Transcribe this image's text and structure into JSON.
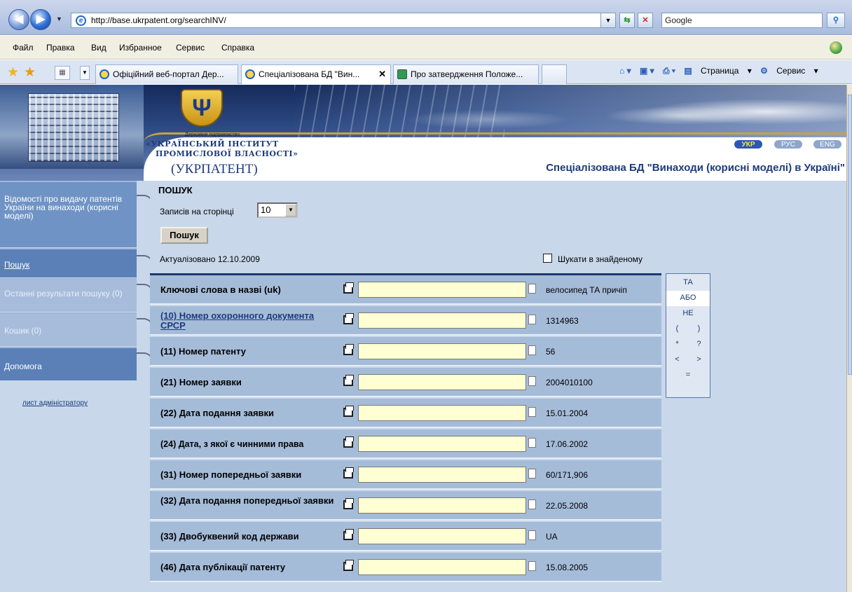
{
  "browser": {
    "url": "http://base.ukrpatent.org/searchINV/",
    "search_placeholder": "Google",
    "menu": [
      "Файл",
      "Правка",
      "Вид",
      "Избранное",
      "Сервис",
      "Справка"
    ],
    "tabs": [
      {
        "label": "Офіційний веб-портал Дер..."
      },
      {
        "label": "Спеціалізована БД \"Вин...",
        "close": "✕"
      },
      {
        "label": "Про затвердження Положе..."
      }
    ],
    "commands": {
      "page": "Страница",
      "service": "Сервис"
    }
  },
  "banner": {
    "org_small": "Державне підприємство",
    "org_line1": "«УКРАЇНСЬКИЙ ІНСТИТУТ",
    "org_line2": "ПРОМИСЛОВОЇ ВЛАСНОСТІ»",
    "org_abbr": "(УКРПАТЕНТ)",
    "languages": [
      "УКР",
      "РУС",
      "ENG"
    ],
    "db_title": "Спеціалізована БД \"Винаходи (корисні моделі) в Україні\""
  },
  "sidenav": {
    "items": [
      "Відомості про видачу патентів України на винаходи (корисні моделі)",
      "Пошук",
      "Останні результати пошуку (0)",
      "Кошик (0)",
      "Допомога"
    ],
    "admin_link": "лист адміністратору"
  },
  "search": {
    "heading": "ПОШУК",
    "per_page_label": "Записів на сторінці",
    "per_page_value": "10",
    "button": "Пошук",
    "updated": "Актуалізовано 12.10.2009",
    "in_found_label": "Шукати в знайденому",
    "fields": [
      {
        "label": "Ключові слова в назві (uk)",
        "example": "велосипед ТА причіп"
      },
      {
        "label": "(10) Номер охоронного документа СРСР",
        "example": "1314963"
      },
      {
        "label": "(11) Номер патенту",
        "example": "56"
      },
      {
        "label": "(21) Номер заявки",
        "example": "2004010100"
      },
      {
        "label": "(22) Дата подання заявки",
        "example": "15.01.2004"
      },
      {
        "label": "(24) Дата, з якої є чинними права",
        "example": "17.06.2002"
      },
      {
        "label": "(31) Номер попередньої заявки",
        "example": "60/171,906"
      },
      {
        "label": "(32) Дата подання попередньої заявки",
        "example": "22.05.2008"
      },
      {
        "label": "(33) Двобуквений код держави",
        "example": "UA"
      },
      {
        "label": "(46) Дата публікації патенту",
        "example": "15.08.2005"
      }
    ],
    "operators": [
      "ТА",
      "АБО",
      "НЕ",
      "(",
      ")",
      "*",
      "?",
      "<",
      ">",
      "="
    ]
  }
}
